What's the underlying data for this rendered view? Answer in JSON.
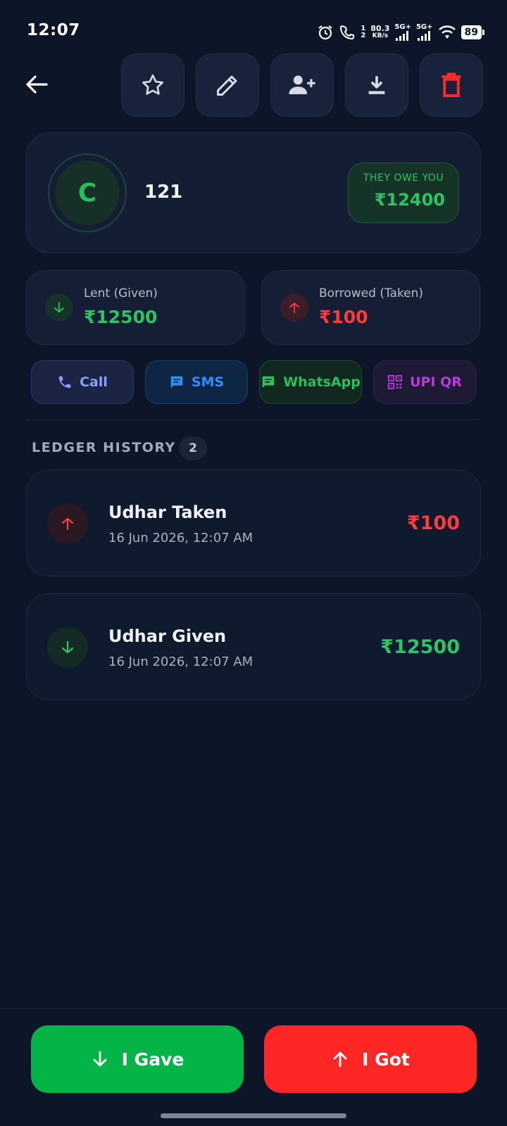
{
  "status_bar": {
    "time": "12:07",
    "call_sim_top": "1",
    "call_sim_bottom": "2",
    "net_speed_value": "80.3",
    "net_speed_unit": "KB/s",
    "signal_1": "5G+",
    "signal_2": "5G+",
    "battery": "89"
  },
  "toolbar": {
    "back_icon": "arrow-left-icon",
    "buttons": [
      {
        "name": "favorite",
        "icon": "star-icon"
      },
      {
        "name": "edit",
        "icon": "pencil-icon"
      },
      {
        "name": "add-contact",
        "icon": "person-add-icon"
      },
      {
        "name": "download",
        "icon": "download-icon"
      },
      {
        "name": "delete",
        "icon": "trash-icon",
        "color": "#ff2b2b"
      }
    ]
  },
  "profile": {
    "initial": "C",
    "name": "121",
    "balance_label": "THEY OWE YOU",
    "balance_amount": "₹12400",
    "accent": "#2dc463"
  },
  "stats": {
    "lent": {
      "label": "Lent (Given)",
      "amount": "₹12500",
      "color": "#2dc463",
      "icon": "arrow-down-icon"
    },
    "borrowed": {
      "label": "Borrowed (Taken)",
      "amount": "₹100",
      "color": "#ff3b3b",
      "icon": "arrow-up-icon"
    }
  },
  "actions": [
    {
      "label": "Call",
      "icon": "phone-icon",
      "color": "#8f9cff"
    },
    {
      "label": "SMS",
      "icon": "message-icon",
      "color": "#2f8df5"
    },
    {
      "label": "WhatsApp",
      "icon": "chat-icon",
      "color": "#2dbf5e"
    },
    {
      "label": "UPI QR",
      "icon": "qr-code-icon",
      "color": "#b53ed6"
    }
  ],
  "ledger": {
    "title": "LEDGER HISTORY",
    "count": "2",
    "entries": [
      {
        "title": "Udhar Taken",
        "date": "16 Jun 2026, 12:07 AM",
        "amount": "₹100",
        "type": "taken",
        "color": "#ff3b3b",
        "icon": "arrow-up-icon"
      },
      {
        "title": "Udhar Given",
        "date": "16 Jun 2026, 12:07 AM",
        "amount": "₹12500",
        "type": "given",
        "color": "#2dc463",
        "icon": "arrow-down-icon"
      }
    ]
  },
  "bottom": {
    "gave_label": "I Gave",
    "gave_color": "#05b447",
    "got_label": "I Got",
    "got_color": "#ff2626"
  }
}
